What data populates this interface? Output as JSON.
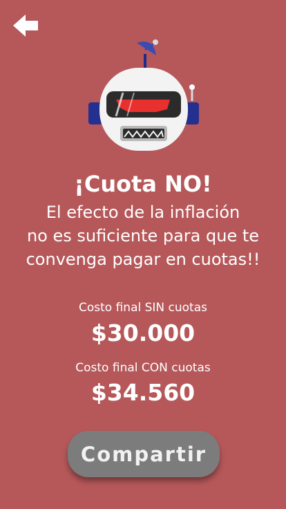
{
  "header": {
    "back_icon": "arrow-left-icon"
  },
  "robot": {
    "icon": "robot-illustration"
  },
  "result": {
    "title": "¡Cuota NO!",
    "message_lines": [
      "El efecto de la inflación",
      "no es suficiente para que te",
      "convenga pagar en cuotas!!"
    ]
  },
  "costs": {
    "without_label": "Costo final SIN cuotas",
    "without_value": "$30.000",
    "with_label": "Costo final CON cuotas",
    "with_value": "$34.560"
  },
  "actions": {
    "share_label": "Compartir"
  },
  "colors": {
    "background": "#B6585A",
    "button": "#7C7C7C",
    "text": "#FFFFFF"
  }
}
